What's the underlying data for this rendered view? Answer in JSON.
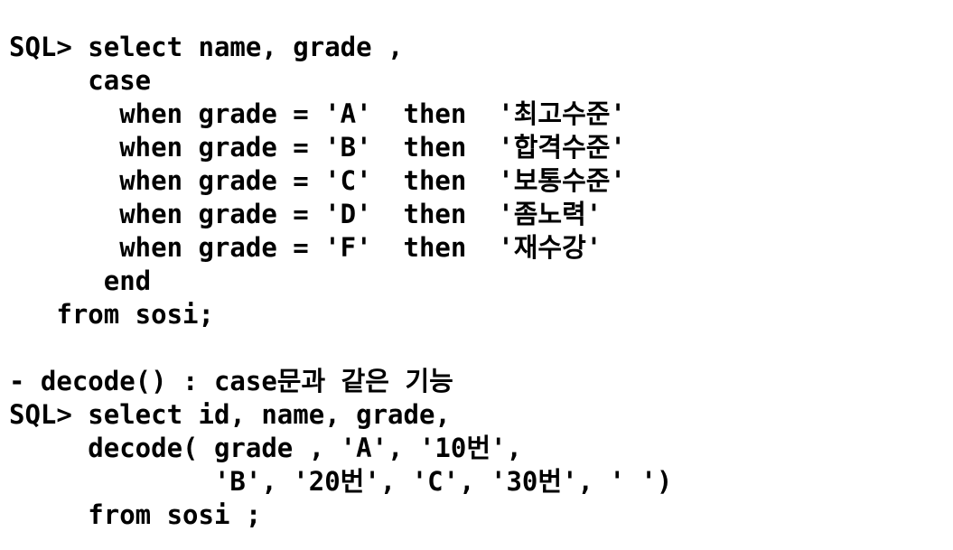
{
  "document": {
    "case_example": [
      "SQL> select name, grade ,",
      "     case",
      "       when grade = 'A'  then  '최고수준'",
      "       when grade = 'B'  then  '합격수준'",
      "       when grade = 'C'  then  '보통수준'",
      "       when grade = 'D'  then  '좀노력'",
      "       when grade = 'F'  then  '재수강'",
      "      end",
      "   from sosi;"
    ],
    "decode_heading": "- decode() : case문과 같은 기능",
    "decode_example": [
      "SQL> select id, name, grade,",
      "     decode( grade , 'A', '10번',",
      "             'B', '20번', 'C', '30번', ' ')",
      "     from sosi ;"
    ]
  }
}
